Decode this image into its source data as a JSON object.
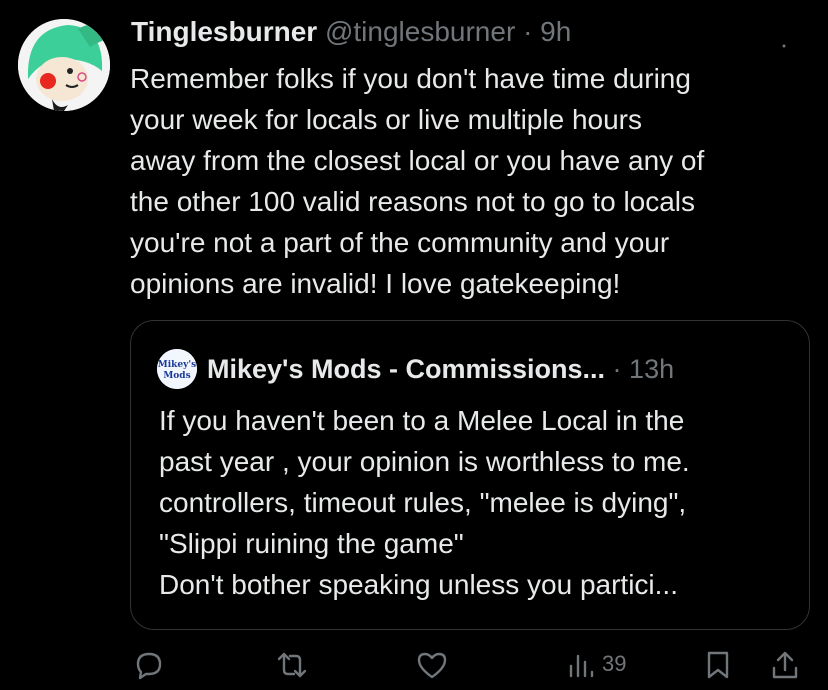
{
  "tweet": {
    "author_name": "Tinglesburner",
    "author_handle": "@tinglesburner",
    "separator": "·",
    "time": "9h",
    "avatar_icon": "green-hood-character-avatar",
    "body_lines": [
      "Remember folks if you don't have time during",
      "your week for locals or live multiple hours",
      "away from the closest local or you have any of",
      "the other 100 valid reasons not to go to locals",
      "you're not a part of the community and your",
      "opinions are invalid! I love gatekeeping!"
    ]
  },
  "quoted_tweet": {
    "author_name": "Mikey's Mods - Commissions...",
    "separator": "·",
    "time": "13h",
    "avatar_text_top": "Mikey's",
    "avatar_text_bottom": "Mods",
    "body_lines": [
      "If you haven't been to a Melee Local in the",
      "past year , your opinion is worthless to me.",
      "controllers, timeout rules, \"melee is dying\",",
      "\"Slippi ruining the game\"",
      "Don't bother speaking unless you partici..."
    ]
  },
  "actions": {
    "views_count": "39",
    "icons": [
      "reply-icon",
      "retweet-icon",
      "like-icon",
      "views-icon",
      "bookmark-icon",
      "share-icon"
    ]
  },
  "colors": {
    "background": "#000000",
    "primary_text": "#e7e9ea",
    "secondary_text": "#71767b",
    "border": "#2f3336",
    "avatar_green": "#3ccf9a"
  }
}
